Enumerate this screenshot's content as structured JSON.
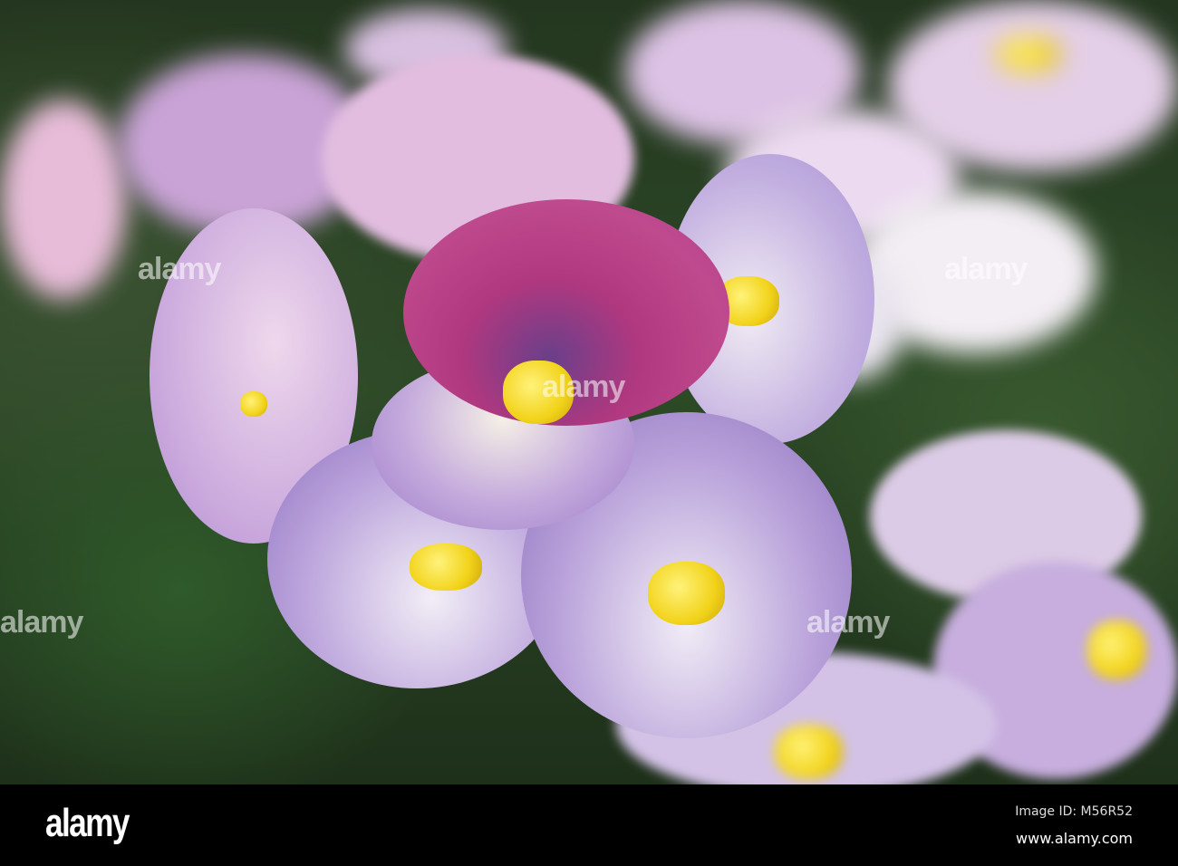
{
  "watermark": "alamy",
  "footer": {
    "logo": "alamy",
    "image_id": "Image ID: M56R52",
    "url": "www.alamy.com"
  },
  "colors": {
    "background": "#2d4a27",
    "magenta": "#b0387f",
    "lilac": "#a98fd0",
    "yellow": "#f2d31a",
    "footer": "#000000"
  }
}
